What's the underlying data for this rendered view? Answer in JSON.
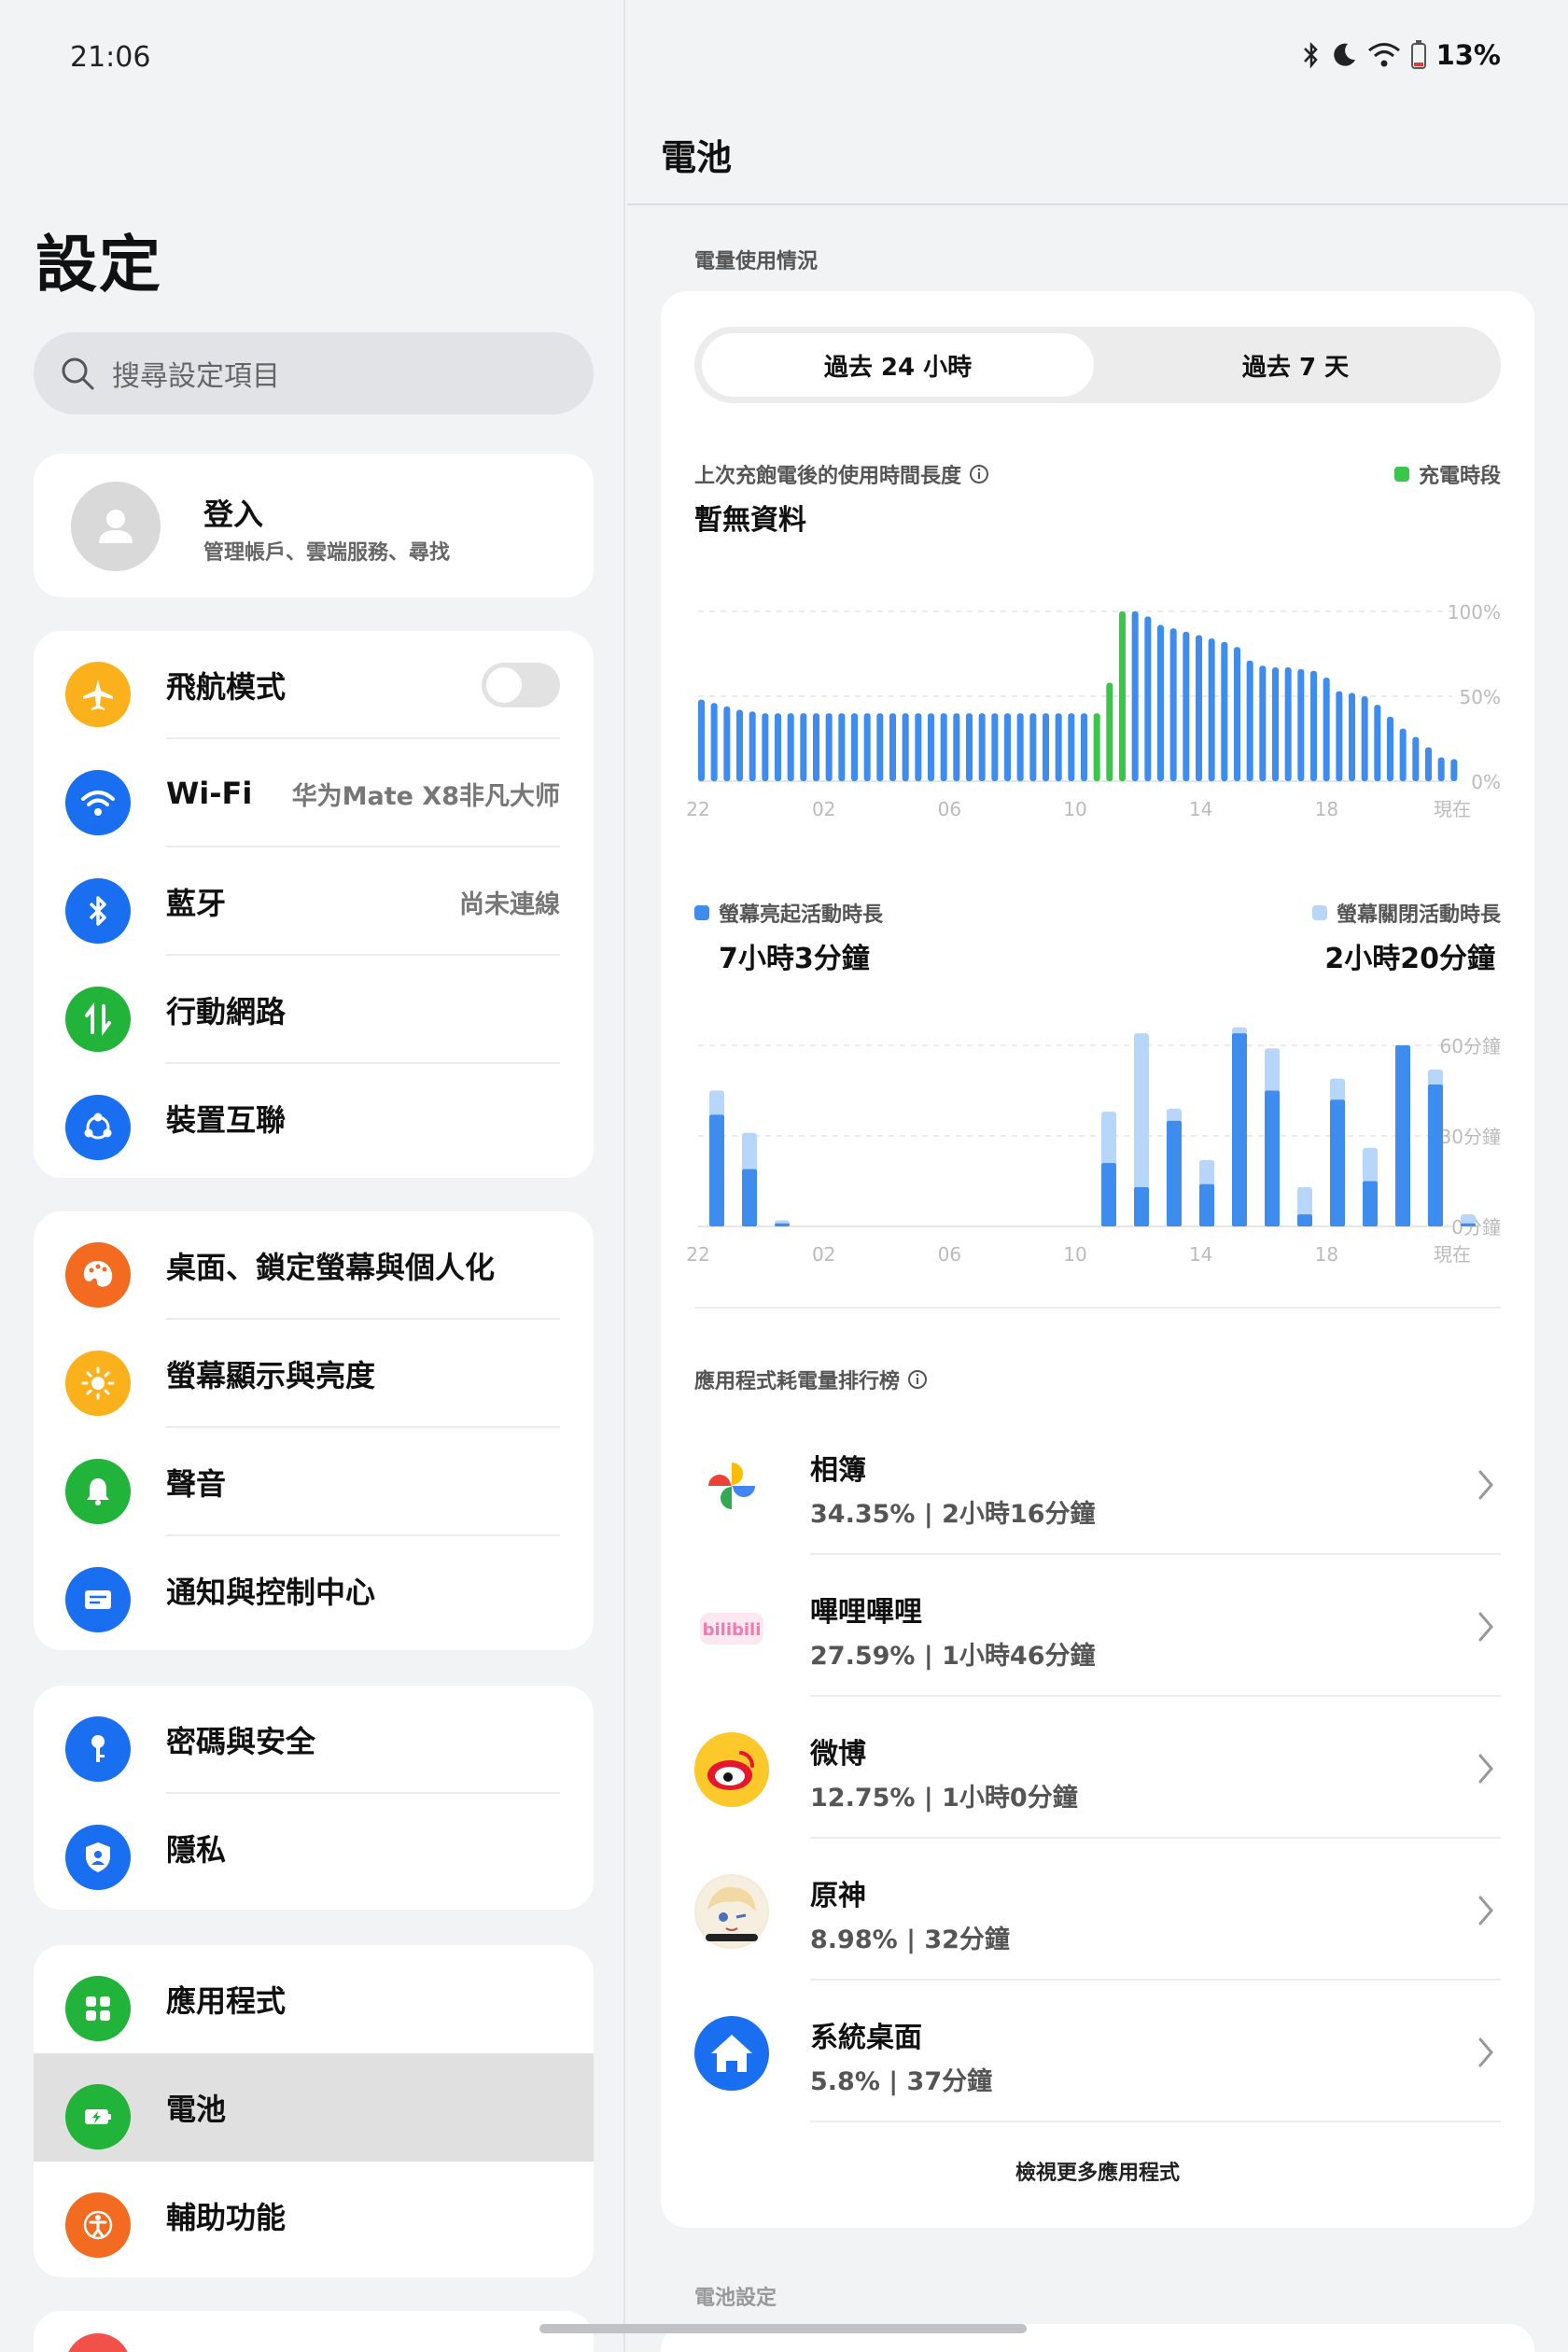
{
  "status": {
    "time": "21:06",
    "battery_pct": "13%"
  },
  "left": {
    "title": "設定",
    "search_placeholder": "搜尋設定項目",
    "account": {
      "title": "登入",
      "subtitle": "管理帳戶、雲端服務、尋找"
    },
    "group1": [
      {
        "label": "飛航模式",
        "value": "",
        "toggle": true
      },
      {
        "label": "Wi-Fi",
        "value": "华为Mate X8非凡大师"
      },
      {
        "label": "藍牙",
        "value": "尚未連線"
      },
      {
        "label": "行動網路",
        "value": ""
      },
      {
        "label": "裝置互聯",
        "value": ""
      }
    ],
    "group2": [
      {
        "label": "桌面、鎖定螢幕與個人化"
      },
      {
        "label": "螢幕顯示與亮度"
      },
      {
        "label": "聲音"
      },
      {
        "label": "通知與控制中心"
      }
    ],
    "group3": [
      {
        "label": "密碼與安全"
      },
      {
        "label": "隱私"
      }
    ],
    "group4": [
      {
        "label": "應用程式"
      },
      {
        "label": "電池"
      },
      {
        "label": "輔助功能"
      }
    ]
  },
  "right": {
    "title": "電池",
    "usage_label": "電量使用情況",
    "tab_active": "過去 24 小時",
    "tab_inactive": "過去 7 天",
    "since_full_label": "上次充飽電後的使用時間長度",
    "since_full_value": "暫無資料",
    "charging_legend": "充電時段",
    "screen_on_label": "螢幕亮起活動時長",
    "screen_on_value": "7小時3分鐘",
    "screen_off_label": "螢幕關閉活動時長",
    "screen_off_value": "2小時20分鐘",
    "ranking_label": "應用程式耗電量排行榜",
    "apps": [
      {
        "name": "相簿",
        "meta": "34.35% | 2小時16分鐘"
      },
      {
        "name": "嗶哩嗶哩",
        "meta": "27.59% | 1小時46分鐘"
      },
      {
        "name": "微博",
        "meta": "12.75% | 1小時0分鐘"
      },
      {
        "name": "原神",
        "meta": "8.98% | 32分鐘"
      },
      {
        "name": "系統桌面",
        "meta": "5.8% | 37分鐘"
      }
    ],
    "view_more": "檢視更多應用程式",
    "next_section": "電池設定"
  },
  "colors": {
    "blue": "#3d8cee",
    "light_blue": "#b8d6fa",
    "green": "#3ac64b",
    "accent": "#1a6ff0"
  },
  "chart_data": [
    {
      "type": "bar",
      "title": "",
      "x_ticks": [
        "22",
        "02",
        "06",
        "10",
        "14",
        "18",
        "現在"
      ],
      "y_ticks": [
        "0%",
        "50%",
        "100%"
      ],
      "ylim": [
        0,
        100
      ],
      "series": [
        {
          "name": "充電時段",
          "values": [
            48,
            46,
            44,
            42,
            41,
            40,
            40,
            40,
            40,
            40,
            40,
            40,
            40,
            40,
            40,
            40,
            40,
            40,
            40,
            40,
            40,
            40,
            40,
            40,
            40,
            40,
            40,
            40,
            40,
            40,
            40,
            40,
            58,
            100,
            100,
            97,
            92,
            90,
            88,
            86,
            84,
            82,
            79,
            71,
            68,
            67,
            67,
            66,
            65,
            61,
            53,
            52,
            50,
            45,
            38,
            31,
            26,
            20,
            14,
            13
          ]
        }
      ],
      "charging_indices": [
        31,
        33
      ]
    },
    {
      "type": "bar",
      "title": "",
      "x_ticks": [
        "22",
        "02",
        "06",
        "10",
        "14",
        "18",
        "現在"
      ],
      "y_ticks": [
        "0分鐘",
        "30分鐘",
        "60分鐘"
      ],
      "ylim": [
        0,
        60
      ],
      "series": [
        {
          "name": "螢幕亮起活動時長",
          "values": [
            37,
            19,
            1,
            0,
            0,
            0,
            0,
            0,
            0,
            0,
            0,
            0,
            21,
            13,
            35,
            14,
            64,
            45,
            4,
            42,
            15,
            60,
            47,
            1
          ]
        },
        {
          "name": "螢幕關閉活動時長",
          "values": [
            8,
            12,
            1,
            0,
            0,
            0,
            0,
            0,
            0,
            0,
            0,
            0,
            17,
            51,
            4,
            8,
            2,
            14,
            9,
            7,
            11,
            0,
            5,
            3
          ]
        }
      ]
    }
  ]
}
